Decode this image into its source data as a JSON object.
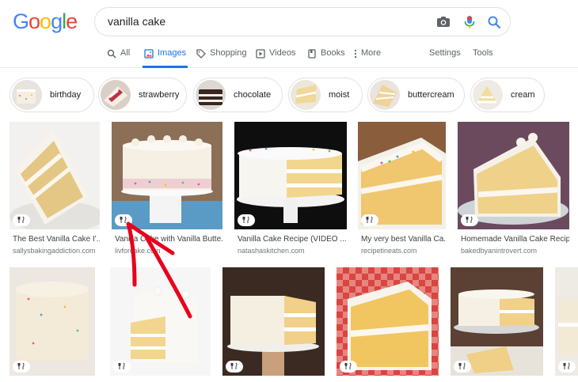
{
  "header": {
    "logo_letters": [
      "G",
      "o",
      "o",
      "g",
      "l",
      "e"
    ],
    "logo_colors": [
      "#4285F4",
      "#EA4335",
      "#FBBC05",
      "#4285F4",
      "#34A853",
      "#EA4335"
    ],
    "search_value": "vanilla cake",
    "camera_icon": "camera-icon",
    "mic_icon": "mic-icon",
    "search_icon": "search-icon"
  },
  "tabs": {
    "all": "All",
    "images": "Images",
    "shopping": "Shopping",
    "videos": "Videos",
    "books": "Books",
    "more": "More",
    "settings": "Settings",
    "tools": "Tools"
  },
  "chips": [
    "birthday",
    "strawberry",
    "chocolate",
    "moist",
    "buttercream",
    "cream"
  ],
  "row1": [
    {
      "title": "The Best Vanilla Cake I'...",
      "source": "sallysbakingaddiction.com"
    },
    {
      "title": "Vanilla Cake with Vanilla Butte...",
      "source": "livforcake.com"
    },
    {
      "title": "Vanilla Cake Recipe (VIDEO ...",
      "source": "natashaskitchen.com"
    },
    {
      "title": "My very best Vanilla Ca...",
      "source": "recipetineats.com"
    },
    {
      "title": "Homemade Vanilla Cake Recip...",
      "source": "bakedbyanintrovert.com"
    }
  ],
  "badge_glyph": "Ψ ",
  "colors": {
    "accent": "#1a73e8",
    "annotation": "#e8001c"
  }
}
